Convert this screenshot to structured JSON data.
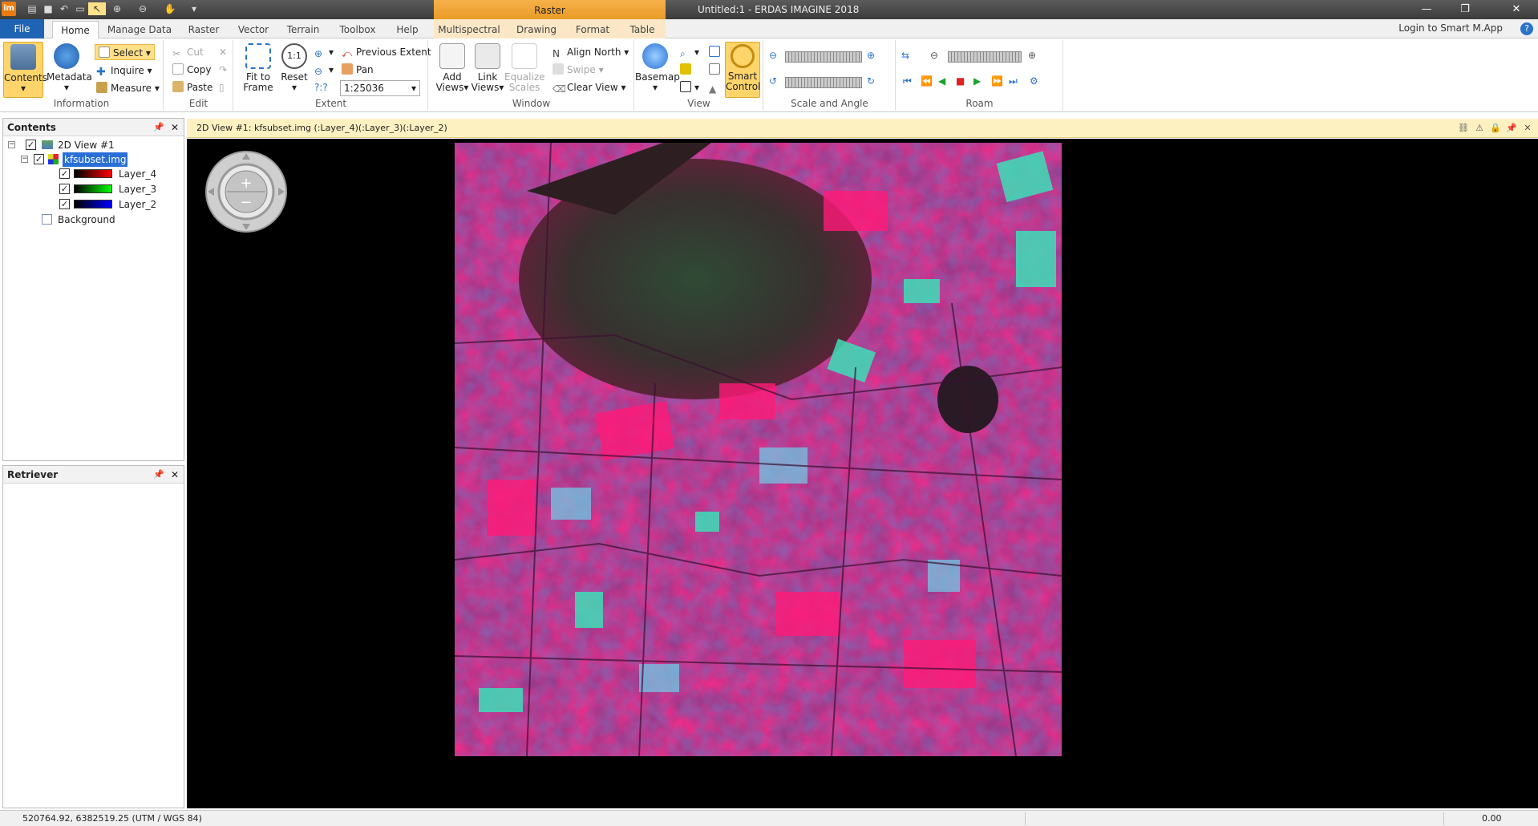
{
  "app": {
    "title": "Untitled:1 - ERDAS IMAGINE 2018",
    "logo_text": "im",
    "contextual_tab_group": "Raster"
  },
  "tabs": {
    "file": "File",
    "items": [
      "Home",
      "Manage Data",
      "Raster",
      "Vector",
      "Terrain",
      "Toolbox",
      "Help",
      "Multispectral",
      "Drawing",
      "Format",
      "Table"
    ],
    "active": "Home",
    "login": "Login to Smart M.App"
  },
  "ribbon": {
    "information": {
      "label": "Information",
      "contents": "Contents",
      "metadata": "Metadata",
      "select": "Select",
      "inquire": "Inquire",
      "measure": "Measure"
    },
    "edit": {
      "label": "Edit",
      "cut": "Cut",
      "copy": "Copy",
      "paste": "Paste"
    },
    "extent": {
      "label": "Extent",
      "fit_to": "Fit to",
      "frame": "Frame",
      "reset": "Reset",
      "previous_extent": "Previous Extent",
      "pan": "Pan",
      "unknown_scale": "?:?",
      "scale": "1:25036"
    },
    "window": {
      "label": "Window",
      "add": "Add",
      "link": "Link",
      "equalize": "Equalize",
      "views": "Views",
      "scales": "Scales",
      "align_north": "Align North",
      "swipe": "Swipe",
      "clear_view": "Clear View"
    },
    "view": {
      "label": "View",
      "basemap": "Basemap",
      "smart": "Smart",
      "control": "Control"
    },
    "scale_angle": {
      "label": "Scale and Angle"
    },
    "roam": {
      "label": "Roam"
    }
  },
  "contents_panel": {
    "title": "Contents",
    "tree": {
      "view": "2D View #1",
      "file": "kfsubset.img",
      "layers": [
        {
          "name": "Layer_4",
          "color": "#ff0000"
        },
        {
          "name": "Layer_3",
          "color": "#00ff00"
        },
        {
          "name": "Layer_2",
          "color": "#0000ff"
        }
      ],
      "background": "Background"
    }
  },
  "retriever_panel": {
    "title": "Retriever"
  },
  "view": {
    "header": "2D View #1: kfsubset.img (:Layer_4)(:Layer_3)(:Layer_2)"
  },
  "status": {
    "coords": "520764.92, 6382519.25   (UTM / WGS 84)",
    "value": "0.00"
  },
  "colors": {
    "file_tab": "#1f63b4",
    "contextual_tab": "#f0a535",
    "view_header": "#fdf1c2",
    "selection": "#2a6fd6"
  }
}
